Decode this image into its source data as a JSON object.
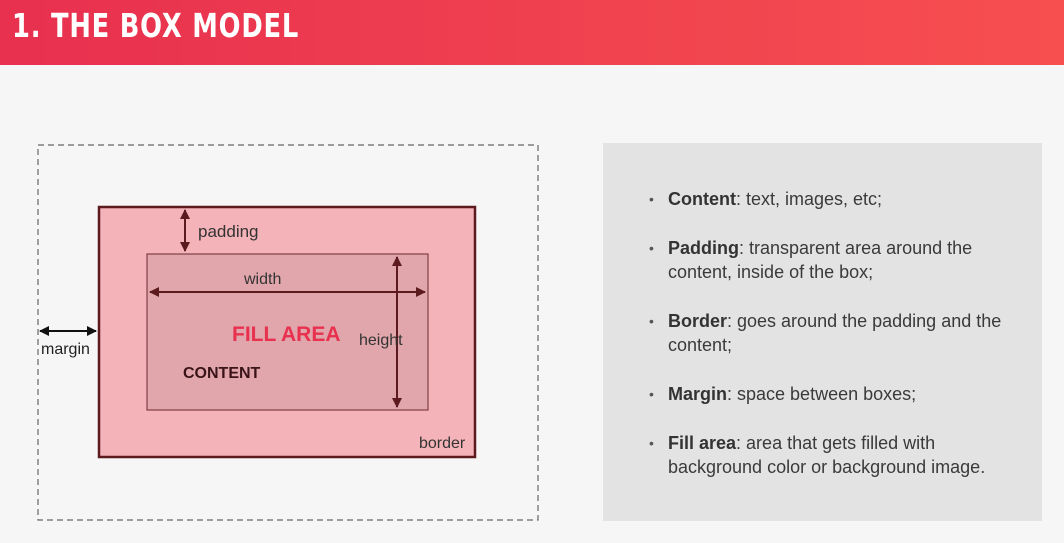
{
  "header": {
    "title": "1. THE BOX MODEL"
  },
  "diagram": {
    "labels": {
      "padding": "padding",
      "width": "width",
      "fill_area": "FILL AREA",
      "height": "height",
      "margin": "margin",
      "content": "CONTENT",
      "border": "border"
    },
    "colors": {
      "fill": "#f4b3b8",
      "content_fill": "#e0a6ab",
      "border": "#5c1a1f",
      "arrow": "#5c1a1f",
      "fill_area_text": "#e8304f",
      "margin_arrow": "#111111"
    }
  },
  "panel": {
    "items": [
      {
        "term": "Content",
        "text": ": text, images, etc;"
      },
      {
        "term": "Padding",
        "text": ": transparent area around the content, inside of the box;"
      },
      {
        "term": "Border",
        "text": ": goes around the padding and the content;"
      },
      {
        "term": "Margin",
        "text": ": space between boxes;"
      },
      {
        "term": "Fill area",
        "text": ": area that gets filled with background color or background image."
      }
    ]
  }
}
